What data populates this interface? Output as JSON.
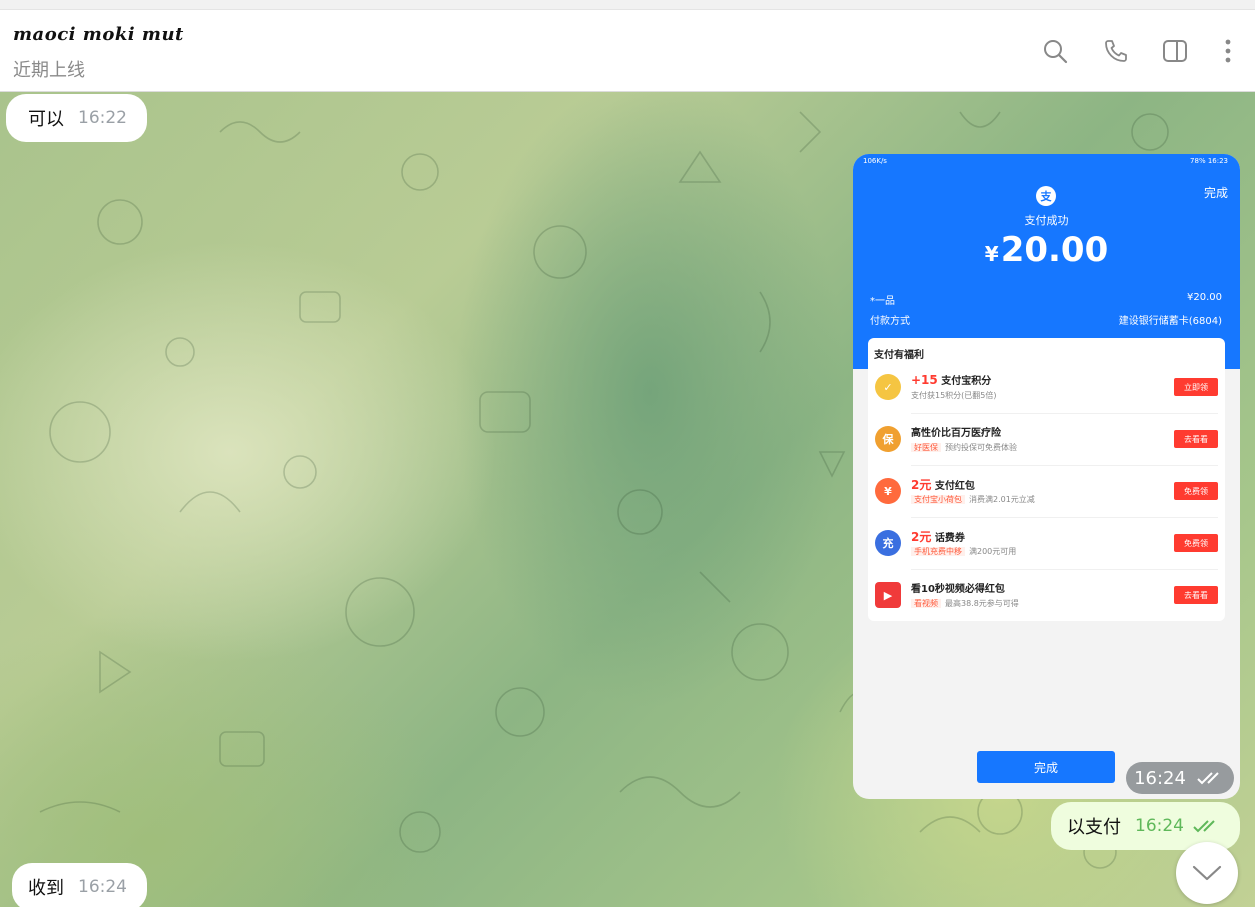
{
  "header": {
    "chat_name": "maoci moki mut",
    "status": "近期上线",
    "icons": [
      "search-icon",
      "phone-icon",
      "sidebar-toggle-icon",
      "more-vertical-icon"
    ]
  },
  "messages": [
    {
      "direction": "in",
      "text": "可以",
      "time": "16:22"
    },
    {
      "direction": "out",
      "type": "photo",
      "time": "16:24",
      "read": "double-check-icon"
    },
    {
      "direction": "out",
      "text": "以支付",
      "time": "16:24",
      "read": "double-check-icon"
    },
    {
      "direction": "in",
      "text": "收到",
      "time": "16:24"
    }
  ],
  "photo": {
    "status_left": "106K/s",
    "status_right": "78% 16:23",
    "logo": "支",
    "done_top": "完成",
    "success": "支付成功",
    "currency": "¥",
    "amount": "20.00",
    "rows": [
      {
        "label": "*一品",
        "value": "¥20.00"
      },
      {
        "label": "付款方式",
        "value": "建设银行储蓄卡(6804)"
      }
    ],
    "benefits_title": "支付有福利",
    "benefits": [
      {
        "highlight": "+15",
        "title": "支付宝积分",
        "tag": "",
        "sub": "支付获15积分(已翻5倍)",
        "button": "立即领",
        "icon": "points-icon",
        "color": "#f5c542"
      },
      {
        "highlight": "",
        "title": "高性价比百万医疗险",
        "tag": "好医保",
        "sub": "预约投保可免费体验",
        "button": "去看看",
        "icon": "insurance-icon",
        "color": "#f0a030"
      },
      {
        "highlight": "2元",
        "title": "支付红包",
        "tag": "支付宝小荷包",
        "sub": "消费满2.01元立减",
        "button": "免费领",
        "icon": "red-packet-icon",
        "color": "#ff6a3d"
      },
      {
        "highlight": "2元",
        "title": "话费券",
        "tag": "手机充费中移",
        "sub": "满200元可用",
        "button": "免费领",
        "icon": "phone-bill-icon",
        "color": "#3a6fe0"
      },
      {
        "highlight": "",
        "title": "看10秒视频必得红包",
        "tag": "看视频",
        "sub": "最高38.8元参与可得",
        "button": "去看看",
        "icon": "video-red-packet-icon",
        "color": "#f03a3a"
      }
    ],
    "done_button": "完成"
  },
  "colors": {
    "alipay_blue": "#1677ff",
    "outgoing_bubble": "#effdde",
    "read_check": "#5fb85a"
  }
}
